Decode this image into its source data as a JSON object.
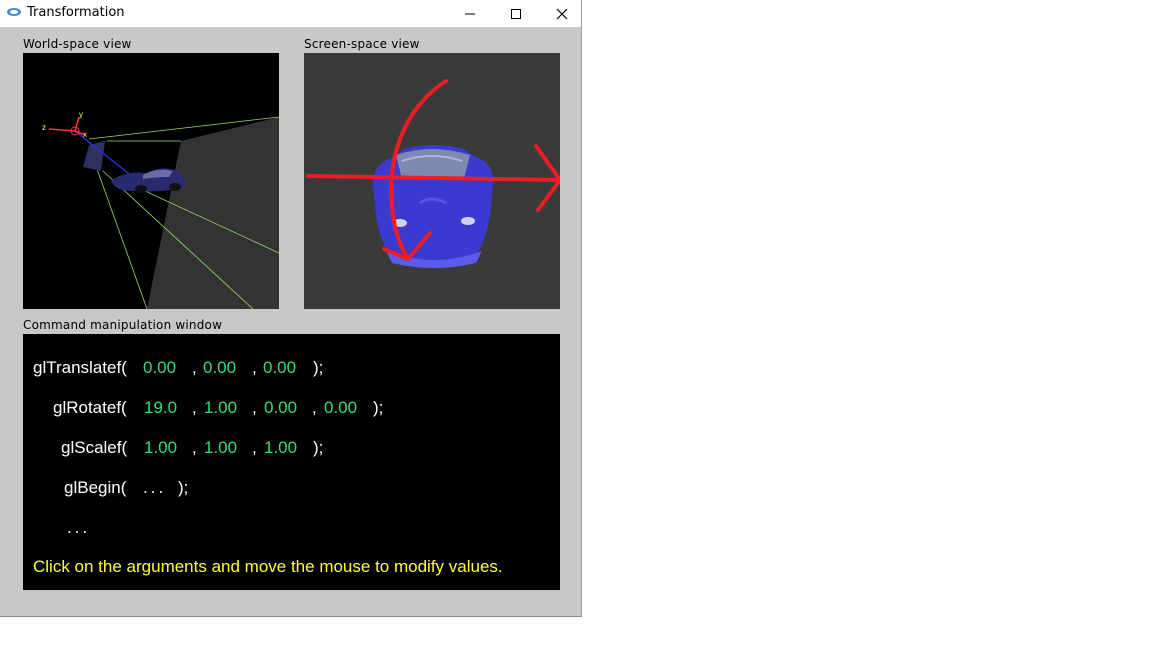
{
  "window": {
    "title": "Transformation",
    "controls": {
      "minimize": "—",
      "maximize": "☐",
      "close": "✕"
    }
  },
  "panels": {
    "world_label": "World-space view",
    "screen_label": "Screen-space view",
    "command_label": "Command manipulation window"
  },
  "axes_labels": {
    "x": "x",
    "y": "y",
    "z": "z"
  },
  "commands": {
    "translate": {
      "name": "glTranslatef(",
      "args": [
        "0.00",
        "0.00",
        "0.00"
      ],
      "close": ");"
    },
    "rotate": {
      "name": "glRotatef(",
      "args": [
        "19.0",
        "1.00",
        "0.00",
        "0.00"
      ],
      "close": ");"
    },
    "scale": {
      "name": "glScalef(",
      "args": [
        "1.00",
        "1.00",
        "1.00"
      ],
      "close": ");"
    },
    "begin": {
      "name": "glBegin(",
      "body": "...",
      "close": ");"
    },
    "ellipsis": "...",
    "separator": ","
  },
  "hint": "Click on the arguments and move the mouse to modify values.",
  "colors": {
    "argument": "#33dd77",
    "hint": "#ffff33",
    "annotation": "#ee1c24",
    "car": "#3333cc"
  }
}
